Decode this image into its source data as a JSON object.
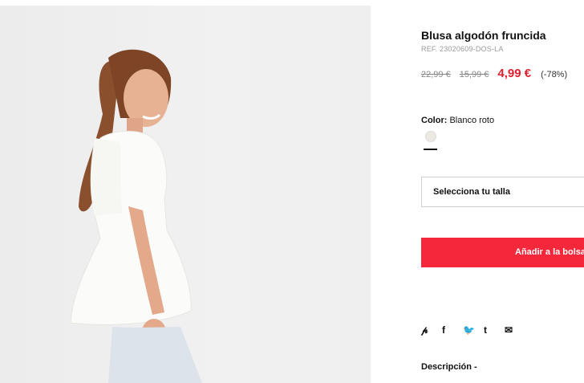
{
  "product": {
    "title": "Blusa algodón fruncida",
    "ref": "REF. 23020609-DOS-LA",
    "prices": {
      "original": "22,99 €",
      "previous": "15,99 €",
      "current": "4,99 €",
      "discount": "(-78%)"
    },
    "color_label": "Color:",
    "color_value": "Blanco roto",
    "size_placeholder": "Selecciona tu talla",
    "add_button": "Añadir a la bolsa",
    "description_label": "Descripción -"
  },
  "social_icons": [
    "pinterest-icon",
    "facebook-icon",
    "twitter-icon",
    "tumblr-icon",
    "email-icon"
  ],
  "colors": {
    "accent": "#f4283a",
    "price": "#e0202e",
    "swatch": "#ece8e2"
  }
}
